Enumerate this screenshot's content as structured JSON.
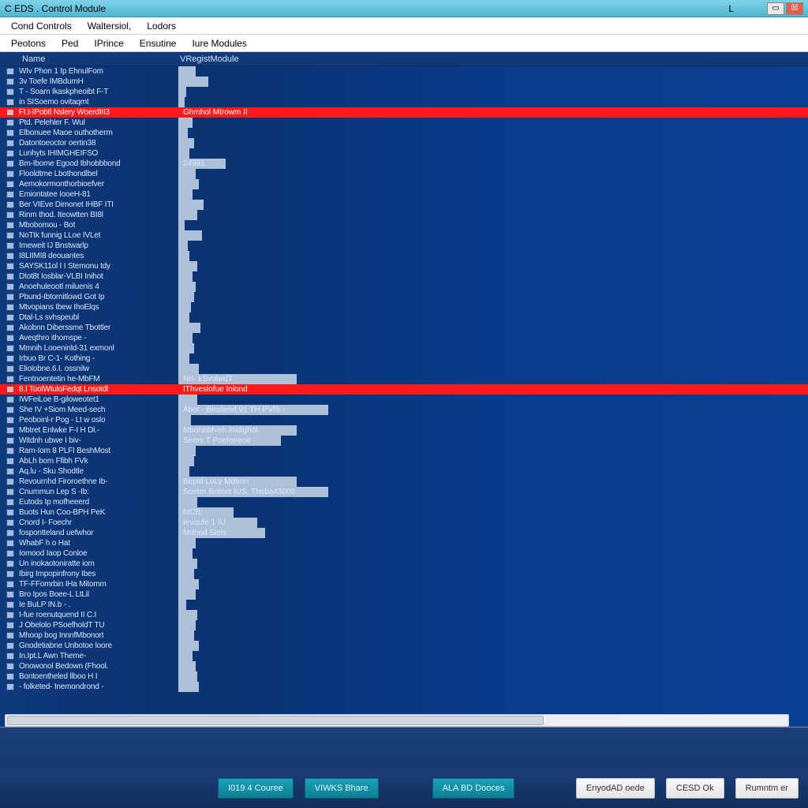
{
  "window": {
    "title": "C EDS . Control Module"
  },
  "menubar1": {
    "items": [
      "Cond Controls",
      "Waltersiol,",
      "Lodors"
    ]
  },
  "menubar2": {
    "items": [
      "Peotons",
      "Ped",
      "IPrince",
      "Ensutine",
      "Iure Modules"
    ]
  },
  "header": {
    "col_name": "Name",
    "col_val": "VRegistModule"
  },
  "colors": {
    "accent_teal": "#1aa0b8",
    "error_red": "#ff1a1a",
    "bar_fill": "#aebfd8"
  },
  "rows": [
    {
      "name": "WIv Phon 1  Ip  EhnulFom",
      "val": "",
      "bar": 22
    },
    {
      "name": "3v  Toefe  IMBdumH",
      "val": "",
      "bar": 38
    },
    {
      "name": "T - Soam Ikaskpheoibt  F-T",
      "val": "",
      "bar": 10
    },
    {
      "name": "in  SISoemo ovitaqmt",
      "val": "",
      "bar": 8
    },
    {
      "name": "FI.t-IPobtl  Nslery WoerdIII3",
      "val": "Ghmhol Mtrowm II",
      "bar": 590,
      "red": true
    },
    {
      "name": "Ptd. Pelehler F. Wul",
      "val": "",
      "bar": 18
    },
    {
      "name": "Elbonuee  Maoe  outhotherm",
      "val": "",
      "bar": 12
    },
    {
      "name": "Datontoeoctor oertin38",
      "val": "",
      "bar": 20
    },
    {
      "name": "Lunhyts IHIMGHEIFSO",
      "val": "",
      "bar": 14
    },
    {
      "name": "Bm-Ibome  Egood Ibhobbbond",
      "val": "24991",
      "bar": 60
    },
    {
      "name": "Flooldtme  Lbothondlbel",
      "val": "",
      "bar": 22
    },
    {
      "name": "Aemokormonthorbioefver",
      "val": "",
      "bar": 26
    },
    {
      "name": "Emiontatee  IooeH-81",
      "val": "",
      "bar": 18
    },
    {
      "name": "Ber VIEve  Dimonet  IHBF ITI",
      "val": "",
      "bar": 32
    },
    {
      "name": "Rinm thod. Iteowtten BI8l",
      "val": "",
      "bar": 24
    },
    {
      "name": "Mbobomou  - Bot",
      "val": "",
      "bar": 8
    },
    {
      "name": "NoTtk  funnig LLoe  IVLet",
      "val": "",
      "bar": 30
    },
    {
      "name": "Imeweit IJ Bnstwarlp",
      "val": "",
      "bar": 12
    },
    {
      "name": "I8LIIMI8 deouantes",
      "val": "",
      "bar": 14
    },
    {
      "name": "SAYSK11ol I I Stemonu tdy",
      "val": "",
      "bar": 24
    },
    {
      "name": "Dtot8t Iosblar-VLBI Inihot",
      "val": "",
      "bar": 18
    },
    {
      "name": "Anoehuleootl miluenis 4",
      "val": "",
      "bar": 22
    },
    {
      "name": "Pbund-Ibtornitlowd  Got Ip",
      "val": "",
      "bar": 20
    },
    {
      "name": "Mtvopians  Ibew IhoElqs",
      "val": "",
      "bar": 16
    },
    {
      "name": "Dtal-Ls  svhspeubl",
      "val": "",
      "bar": 14
    },
    {
      "name": "Akobnn Diberssme Tbottler",
      "val": "",
      "bar": 28
    },
    {
      "name": "Aveqthro ithomspe  -",
      "val": "",
      "bar": 18
    },
    {
      "name": "Mmnih Looeninld-31 exmonl",
      "val": "",
      "bar": 20
    },
    {
      "name": "Irbuo Br  C-1- Kothing  -",
      "val": "",
      "bar": 14
    },
    {
      "name": "Eliolobne.6.I. ossnilw",
      "val": "",
      "bar": 26
    },
    {
      "name": "Fentnoentetin he-MbFM",
      "val": "NrI- kSvolwdT",
      "bar": 150
    },
    {
      "name": "8.I  ToolWtuloFedqt Lnsotdl",
      "val": "IThveslofue Inlond",
      "bar": 120,
      "red": true
    },
    {
      "name": "IWFeiLoe  B-giloweotet1",
      "val": "",
      "bar": 24
    },
    {
      "name": "She IV  +Siom Meed-sech",
      "val": "Abot - Bloslend  91 TH PVfS -",
      "bar": 190
    },
    {
      "name": "Peoboinl-r  Pog  -  Lt w oslo",
      "val": "",
      "bar": 16
    },
    {
      "name": "Mbtret  Enlwke F-I  H Dl.-",
      "val": "Mbonebfveh ihidighot",
      "bar": 150
    },
    {
      "name": "Witdnh ubwe I biv-",
      "val": "Seers  T  Poefeireoe",
      "bar": 130
    },
    {
      "name": "Ram-Iom  8  PLFI BeshMost",
      "val": "",
      "bar": 22
    },
    {
      "name": "AbLh bom  Ffibh  FVk",
      "val": "",
      "bar": 20
    },
    {
      "name": "Aq.lu - Sku  Shodtle",
      "val": "",
      "bar": 14
    },
    {
      "name": "Revournhd  Firoroethne Ib-",
      "val": "Bepld  LoLy Mdtmn",
      "bar": 150
    },
    {
      "name": "Cnummun  Lep  S  -Ib:",
      "val": "Soeter Botoet  IUS.  Theba43009",
      "bar": 190
    },
    {
      "name": "Eutods Ip  mofheeerd",
      "val": "",
      "bar": 24
    },
    {
      "name": "Buots Hun  Coo-BPH PeK",
      "val": "MCB:",
      "bar": 70
    },
    {
      "name": "Cnord  I-  Foechr",
      "val": "Ievoufe 1 IU",
      "bar": 100
    },
    {
      "name": "fospontteland uefwhor",
      "val": "Mdhod  Slels",
      "bar": 110
    },
    {
      "name": "WhabF h o Hat",
      "val": "",
      "bar": 22
    },
    {
      "name": "Iomood Iaop  Conloe",
      "val": "",
      "bar": 18
    },
    {
      "name": "Un inokaotoniratte iom",
      "val": "",
      "bar": 24
    },
    {
      "name": "Ibirg  Impopinfrony  Ibes",
      "val": "",
      "bar": 20
    },
    {
      "name": "TF-FFomrbin IHa Mitomm",
      "val": "",
      "bar": 26
    },
    {
      "name": "Bro  Ipos  Boee-L LtLil",
      "val": "",
      "bar": 22
    },
    {
      "name": "Ie BuLP  IN.b  -  .",
      "val": "",
      "bar": 10
    },
    {
      "name": "I-fue  roenutquend II C.I",
      "val": "",
      "bar": 24
    },
    {
      "name": "J Obelolo PSoefholdT TU",
      "val": "",
      "bar": 22
    },
    {
      "name": "Mhoop bog InnnfMbonort",
      "val": "",
      "bar": 20
    },
    {
      "name": "Gnodetiabne Unbotoe loore",
      "val": "",
      "bar": 26
    },
    {
      "name": "In.Ipt.L  Awn Theme-",
      "val": "",
      "bar": 18
    },
    {
      "name": "Onowonol Bedown  (Fhool.",
      "val": "",
      "bar": 22
    },
    {
      "name": "Bontoentheled  llboo H  I",
      "val": "",
      "bar": 24
    },
    {
      "name": "-  folketed- Inemondrond -",
      "val": "",
      "bar": 26
    }
  ],
  "buttons": {
    "b1": "I019 4 Couree",
    "b2": "VIWKS Bhare",
    "b3": "ALA BD Dooces",
    "b4": "EnyodAD oede",
    "b5": "CESD Ok",
    "b6": "Rumntm  er"
  }
}
